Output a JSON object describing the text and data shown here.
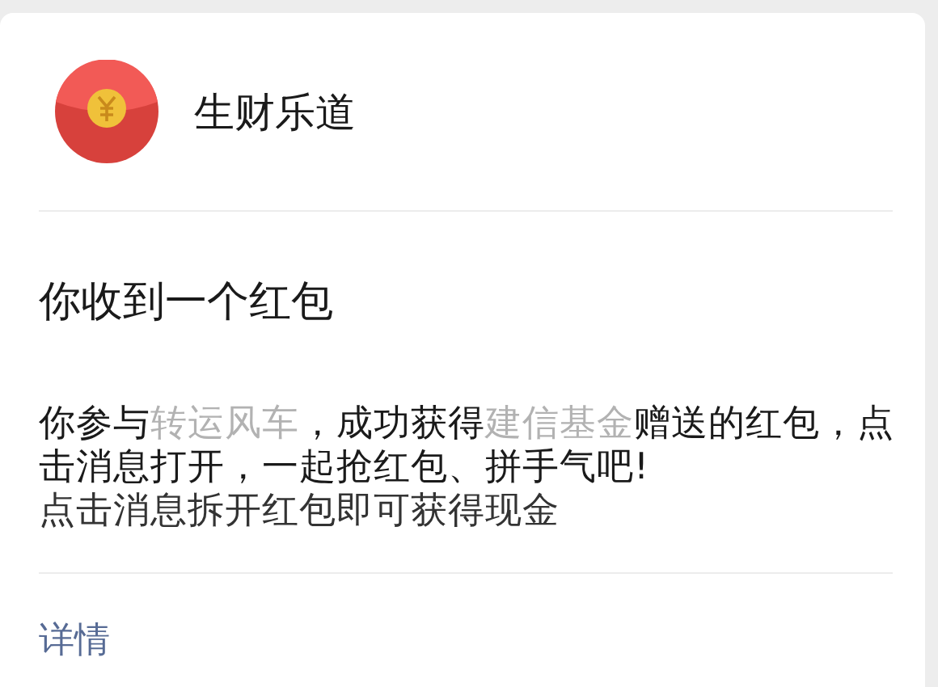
{
  "sender": {
    "name": "生财乐道"
  },
  "card": {
    "title": "你收到一个红包",
    "message": [
      {
        "kind": "plain",
        "text": "你参与"
      },
      {
        "kind": "highlight",
        "text": "转运风车"
      },
      {
        "kind": "plain",
        "text": "，成功获得"
      },
      {
        "kind": "highlight",
        "text": "建信基金"
      },
      {
        "kind": "plain",
        "text": "赠送的红包，点击消息打开，一起抢红包、拼手气吧!"
      }
    ],
    "hint": "点击消息拆开红包即可获得现金"
  },
  "details_link": "详情"
}
